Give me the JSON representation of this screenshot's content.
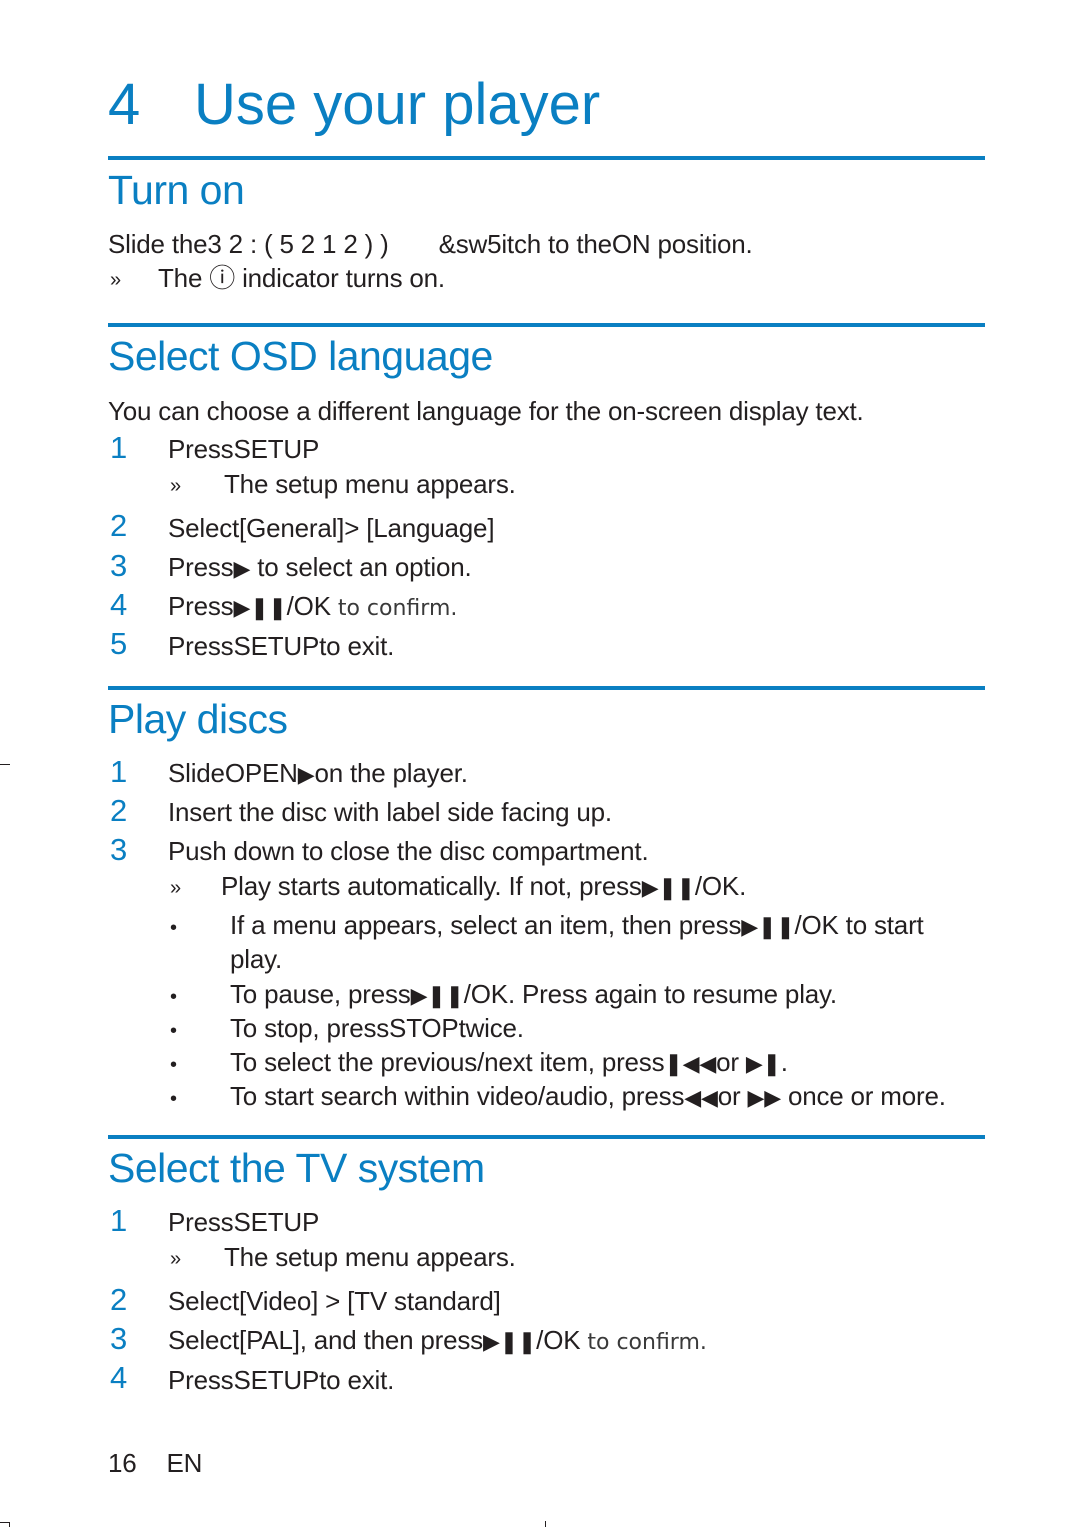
{
  "chapter": {
    "number": "4",
    "title": "Use your player"
  },
  "sections": {
    "turn_on": {
      "heading": "Turn on",
      "line1_pre": "Slide the",
      "line1_garbled": "3 2 : ( 5   2 1   2 ) )",
      "line1_switch": "&sw5itch to the",
      "line1_on": "ON",
      "line1_post": " position.",
      "result_marker": "»",
      "result_pre": "The",
      "result_icon": "ⓘ",
      "result_post": " indicator turns on."
    },
    "osd": {
      "heading": "Select OSD language",
      "intro": "You can choose a different language for the on-screen display text.",
      "steps": [
        {
          "num": "1",
          "text": "PressSETUP"
        },
        {
          "num": "2",
          "text": "Select[General]> [Language]"
        },
        {
          "num": "3",
          "pre": "Press",
          "icon": "▶",
          "post": " to select an option."
        },
        {
          "num": "4",
          "pre": "Press",
          "icon": "▶❚❚",
          "post": "/OK",
          "light": " to confirm."
        },
        {
          "num": "5",
          "text": "PressSETUPto exit."
        }
      ],
      "result_marker": "»",
      "result": "The setup menu appears."
    },
    "play": {
      "heading": "Play discs",
      "steps": [
        {
          "num": "1",
          "pre": "SlideOPEN",
          "icon": "▶",
          "post": "on the player."
        },
        {
          "num": "2",
          "text": "Insert the disc with label side facing up."
        },
        {
          "num": "3",
          "text": "Push down to close the disc compartment."
        }
      ],
      "result_marker": "»",
      "result_pre": "Play starts automatically. If not, press",
      "result_icon": "▶❚❚",
      "result_post": "/OK.",
      "bullet_marker": "•",
      "bullets": [
        {
          "pre": "If a menu appears, select an item, then press",
          "icon": "▶❚❚",
          "post": "/OK to start",
          "cont": "play."
        },
        {
          "pre": "To pause, press",
          "icon": "▶❚❚",
          "post": "/OK. Press again to resume play."
        },
        {
          "pre": "To stop, pressSTOPtwice."
        },
        {
          "pre": "To select the previous/next item, press",
          "icon": "❚◀◀",
          "mid": "or ",
          "icon2": "▶❚",
          "post": "."
        },
        {
          "pre": "To start search within video/audio, press",
          "icon": "◀◀",
          "mid": "or ",
          "icon2": "▶▶",
          "post": " once or more."
        }
      ]
    },
    "tv": {
      "heading": "Select the TV system",
      "steps": [
        {
          "num": "1",
          "text": "PressSETUP"
        },
        {
          "num": "2",
          "text": "Select[Video] > [TV standard]"
        },
        {
          "num": "3",
          "pre": "Select[PAL], and then press",
          "icon": "▶❚❚",
          "post": "/OK",
          "light": " to confirm."
        },
        {
          "num": "4",
          "text": "PressSETUPto exit."
        }
      ],
      "result_marker": "»",
      "result": "The setup menu appears."
    }
  },
  "footer": {
    "page": "16",
    "lang": "EN"
  },
  "colors": {
    "accent": "#0a7fc2",
    "text": "#231f20"
  }
}
